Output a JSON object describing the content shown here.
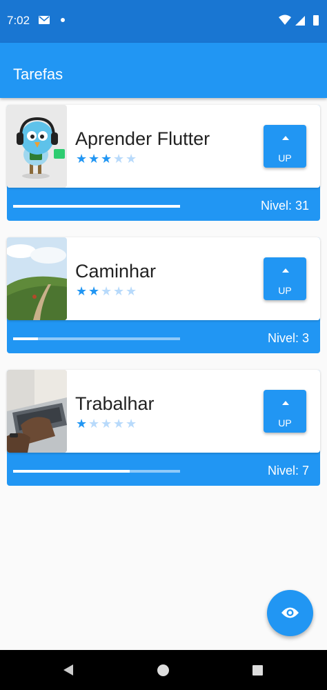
{
  "status_bar": {
    "time": "7:02",
    "icons": [
      "mail-icon",
      "dot-icon",
      "wifi-icon",
      "signal-icon",
      "battery-icon"
    ]
  },
  "app_bar": {
    "title": "Tarefas"
  },
  "tasks": [
    {
      "name": "Aprender Flutter",
      "difficulty": 3,
      "max_stars": 5,
      "level_label": "Nivel: 31",
      "progress": 1.0,
      "up_label": "UP",
      "image": "flutter-mascot-image"
    },
    {
      "name": "Caminhar",
      "difficulty": 2,
      "max_stars": 5,
      "level_label": "Nivel: 3",
      "progress": 0.15,
      "up_label": "UP",
      "image": "hiking-trail-image"
    },
    {
      "name": "Trabalhar",
      "difficulty": 1,
      "max_stars": 5,
      "level_label": "Nivel: 7",
      "progress": 0.7,
      "up_label": "UP",
      "image": "laptop-typing-image"
    }
  ],
  "fab": {
    "icon": "eye-icon"
  },
  "nav_bar": {
    "icons": [
      "back-icon",
      "home-icon",
      "recents-icon"
    ]
  },
  "colors": {
    "primary": "#2196f3",
    "status_bar": "#1976d2",
    "star_off": "#b8dafb",
    "progress_track": "#90caf9"
  }
}
